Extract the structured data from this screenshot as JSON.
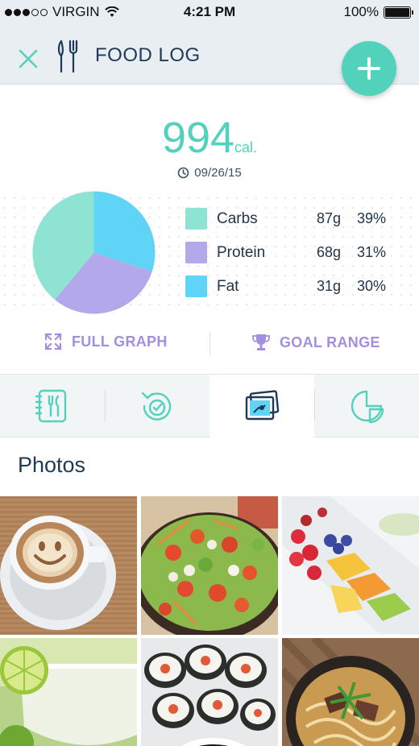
{
  "status_bar": {
    "carrier": "VIRGIN",
    "time": "4:21 PM",
    "battery": "100%",
    "signal_bars": 3
  },
  "header": {
    "title": "FOOD LOG",
    "icons": {
      "close": "close-icon",
      "fork_knife": "fork-knife-icon",
      "add": "plus-icon"
    }
  },
  "summary": {
    "calories": "994",
    "calories_unit": "cal.",
    "date": "09/26/15"
  },
  "chart_data": {
    "type": "pie",
    "slices": [
      {
        "name": "Carbs",
        "grams": "87g",
        "percent": 39,
        "color": "#8ee3d2"
      },
      {
        "name": "Protein",
        "grams": "68g",
        "percent": 31,
        "color": "#b3a8ea"
      },
      {
        "name": "Fat",
        "grams": "31g",
        "percent": 30,
        "color": "#5fd4f6"
      }
    ],
    "legend_placement": "right"
  },
  "legend_display": [
    {
      "name": "Carbs",
      "grams": "87g",
      "percent": "39%"
    },
    {
      "name": "Protein",
      "grams": "68g",
      "percent": "31%"
    },
    {
      "name": "Fat",
      "grams": "31g",
      "percent": "30%"
    }
  ],
  "actions": {
    "full_graph": "FULL GRAPH",
    "goal_range": "GOAL RANGE"
  },
  "tabs": [
    {
      "icon": "food-diary-icon",
      "active": false
    },
    {
      "icon": "history-icon",
      "active": false
    },
    {
      "icon": "photos-icon",
      "active": true
    },
    {
      "icon": "pie-chart-icon",
      "active": false
    }
  ],
  "photos_section": {
    "title": "Photos",
    "items": [
      "latte-art-coffee",
      "salad",
      "fruit-platter",
      "margarita",
      "sushi-rolls",
      "noodle-soup"
    ]
  },
  "colors": {
    "accent": "#52d1bb",
    "purple": "#a38fe0",
    "navy": "#1e3a56"
  }
}
